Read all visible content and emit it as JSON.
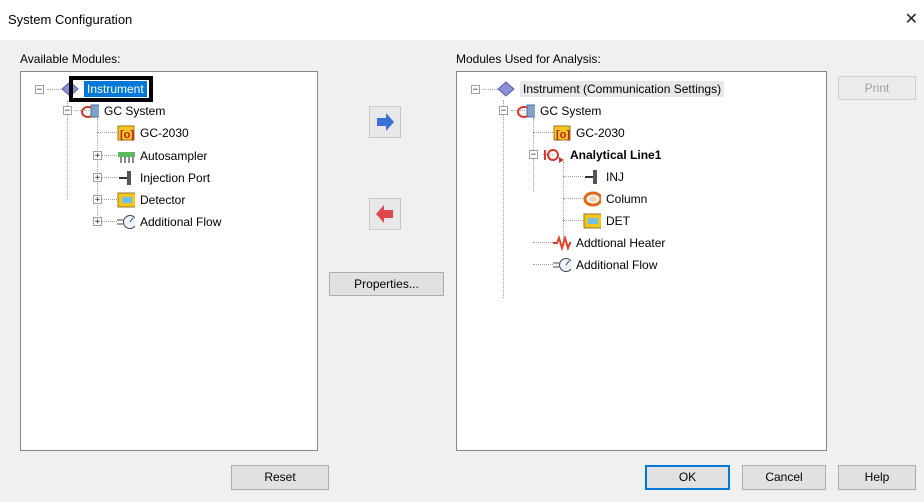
{
  "window": {
    "title": "System Configuration",
    "close_glyph": "✕"
  },
  "left": {
    "label": "Available Modules:",
    "nodes": [
      {
        "label": "Instrument",
        "icon": "diamond-icon"
      },
      {
        "label": "GC System",
        "icon": "gc-system-icon"
      },
      {
        "label": "GC-2030",
        "icon": "gc-unit-icon"
      },
      {
        "label": "Autosampler",
        "icon": "autosampler-icon"
      },
      {
        "label": "Injection Port",
        "icon": "injection-port-icon"
      },
      {
        "label": "Detector",
        "icon": "detector-icon"
      },
      {
        "label": "Additional Flow",
        "icon": "flow-controller-icon"
      }
    ]
  },
  "right": {
    "label": "Modules Used for Analysis:",
    "nodes": [
      {
        "label": "Instrument (Communication Settings)",
        "icon": "diamond-icon"
      },
      {
        "label": "GC System",
        "icon": "gc-system-icon"
      },
      {
        "label": "GC-2030",
        "icon": "gc-unit-icon"
      },
      {
        "label": "Analytical Line1",
        "icon": "analytical-line-icon"
      },
      {
        "label": "INJ",
        "icon": "injection-port-icon"
      },
      {
        "label": "Column",
        "icon": "column-icon"
      },
      {
        "label": "DET",
        "icon": "detector-icon"
      },
      {
        "label": "Addtional Heater",
        "icon": "heater-icon"
      },
      {
        "label": "Additional Flow",
        "icon": "flow-controller-icon"
      }
    ]
  },
  "buttons": {
    "add": "add-arrow",
    "remove": "remove-arrow",
    "properties": "Properties...",
    "print": "Print",
    "reset": "Reset",
    "ok": "OK",
    "cancel": "Cancel",
    "help": "Help"
  },
  "colors": {
    "accent": "#0078d7",
    "add_arrow": "#3b6fd6",
    "remove_arrow": "#e0474c"
  }
}
